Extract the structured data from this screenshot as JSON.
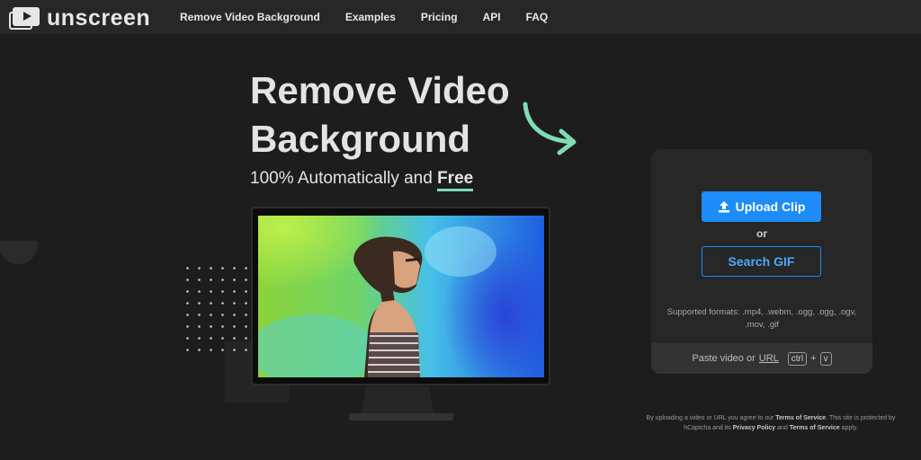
{
  "logo": {
    "text": "unscreen",
    "icon": "play-stack-icon"
  },
  "nav": {
    "links": [
      "Remove Video Background",
      "Examples",
      "Pricing",
      "API",
      "FAQ"
    ]
  },
  "hero": {
    "title_line1": "Remove Video",
    "title_line2": "Background",
    "subtitle_prefix": "100% Automatically and ",
    "subtitle_highlight": "Free",
    "accent_color": "#7fdcb3"
  },
  "card": {
    "upload_label": "Upload Clip",
    "upload_icon": "upload-icon",
    "or_label": "or",
    "search_label": "Search GIF",
    "formats_text": "Supported formats: .mp4, .webm, .ogg, .ogg, .ogv, .mov, .gif",
    "paste_prefix": "Paste video or",
    "paste_url": "URL",
    "key_ctrl": "ctrl",
    "key_plus": "+",
    "key_v": "v",
    "button_color": "#1d8cf8"
  },
  "terms": {
    "part1": "By uploading a video or URL you agree to our ",
    "tos1": "Terms of Service",
    "part2": ". This site is protected by hCaptcha and its ",
    "privacy": "Privacy Policy",
    "part3": " and ",
    "tos2": "Terms of Service",
    "part4": " apply."
  }
}
